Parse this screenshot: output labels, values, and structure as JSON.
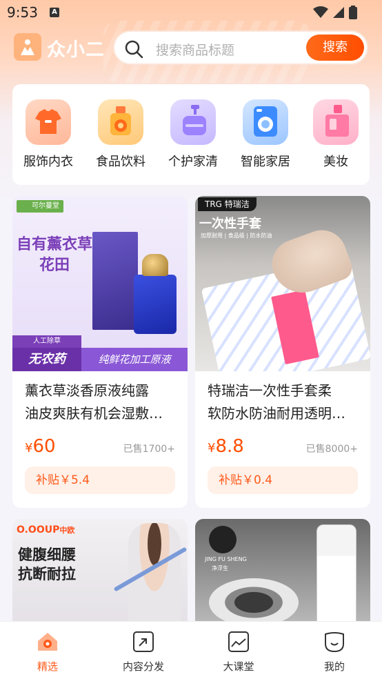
{
  "status_bar": {
    "time": "9:53",
    "notif_letter": "A"
  },
  "header": {
    "app_name": "众小二",
    "search_placeholder": "搜索商品标题",
    "search_button": "搜索"
  },
  "categories": [
    {
      "label": "服饰内衣",
      "icon": "shirt-icon",
      "color": "#ff7a3c"
    },
    {
      "label": "食品饮料",
      "icon": "drink-icon",
      "color": "#ffb43c"
    },
    {
      "label": "个护家清",
      "icon": "lotion-bottle-icon",
      "color": "#8a6cf2"
    },
    {
      "label": "智能家居",
      "icon": "washing-machine-icon",
      "color": "#3c8cff"
    },
    {
      "label": "美妆",
      "icon": "perfume-icon",
      "color": "#ff5a8c"
    }
  ],
  "products": [
    {
      "brand_tag": "可尔蔓堂",
      "headline_line1": "自有薰衣草",
      "headline_line2": "花田",
      "badge_small": "人工除草",
      "badge_big": "无农药",
      "banner": "纯鲜花加工原液",
      "title_line1": "薰衣草淡香原液纯露",
      "title_line2": "油皮爽肤有机会湿敷…",
      "price_currency": "¥",
      "price": "60",
      "sold": "已售1700+",
      "subsidy": "补贴￥5.4"
    },
    {
      "brand_tag": "TRG",
      "brand_name": "特瑞洁",
      "headline": "一次性手套",
      "subline": "加厚耐用 | 食品级 | 防水防油",
      "title_line1": "特瑞洁一次性手套柔",
      "title_line2": "软防水防油耐用透明…",
      "price_currency": "¥",
      "price": "8.8",
      "sold": "已售8000+",
      "subsidy": "补贴￥0.4"
    },
    {
      "brand_tag": "O.OOUP",
      "brand_sub": "中欧",
      "headline_line1": "健腹细腰",
      "headline_line2": "抗断耐拉"
    },
    {
      "brand_tag": "JING FU SHENG",
      "brand_sub": "净浮生"
    }
  ],
  "tabs": [
    {
      "label": "精选",
      "icon": "home-icon",
      "active": true
    },
    {
      "label": "内容分发",
      "icon": "share-icon",
      "active": false
    },
    {
      "label": "大课堂",
      "icon": "classroom-icon",
      "active": false
    },
    {
      "label": "我的",
      "icon": "profile-icon",
      "active": false
    }
  ],
  "colors": {
    "accent": "#ff5a1a",
    "background": "#f5f4fa"
  }
}
